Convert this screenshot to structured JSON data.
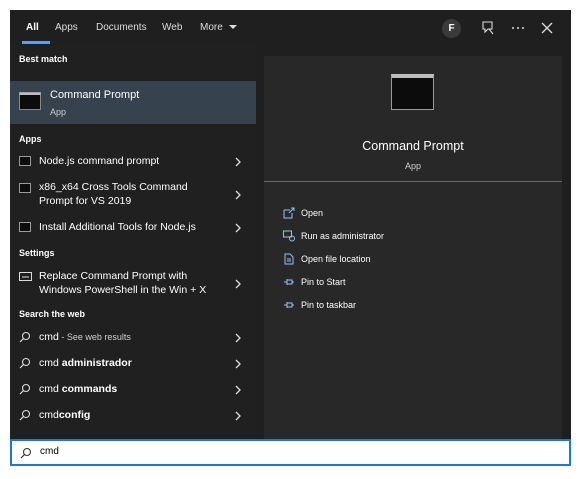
{
  "tabs": [
    {
      "label": "All",
      "active": true
    },
    {
      "label": "Apps"
    },
    {
      "label": "Documents"
    },
    {
      "label": "Web"
    },
    {
      "label": "More"
    }
  ],
  "header": {
    "avatar_letter": "F",
    "icons": [
      "feedback-icon",
      "more-options-icon",
      "close-icon"
    ]
  },
  "left": {
    "best_match_heading": "Best match",
    "best_match": {
      "title": "Command Prompt",
      "subtitle": "App",
      "icon": "terminal-icon"
    },
    "apps_heading": "Apps",
    "apps": [
      {
        "label": "Node.js command prompt"
      },
      {
        "label_line1": "x86_x64 Cross Tools Command",
        "label_line2": "Prompt for VS 2019"
      },
      {
        "label": "Install Additional Tools for Node.js"
      }
    ],
    "settings_heading": "Settings",
    "settings": [
      {
        "label_line1": "Replace Command Prompt with",
        "label_line2": "Windows PowerShell in the Win + X"
      }
    ],
    "web_heading": "Search the web",
    "web": [
      {
        "prefix": "cmd",
        "suffix": " - See web results"
      },
      {
        "prefix": "cmd ",
        "bold": "administrador"
      },
      {
        "prefix": "cmd ",
        "bold": "commands"
      },
      {
        "prefix": "cmd",
        "bold": "config"
      }
    ]
  },
  "right": {
    "title": "Command Prompt",
    "subtitle": "App",
    "actions": [
      {
        "label": "Open",
        "icon": "open-icon"
      },
      {
        "label": "Run as administrator",
        "icon": "shield-icon"
      },
      {
        "label": "Open file location",
        "icon": "file-location-icon"
      },
      {
        "label": "Pin to Start",
        "icon": "pin-icon"
      },
      {
        "label": "Pin to taskbar",
        "icon": "pin-icon"
      }
    ]
  },
  "search": {
    "value": "cmd",
    "icon": "search-icon"
  },
  "colors": {
    "accent": "#1e78d4",
    "tab_underline": "#4aa7ff",
    "selected_row": "#36424d"
  }
}
